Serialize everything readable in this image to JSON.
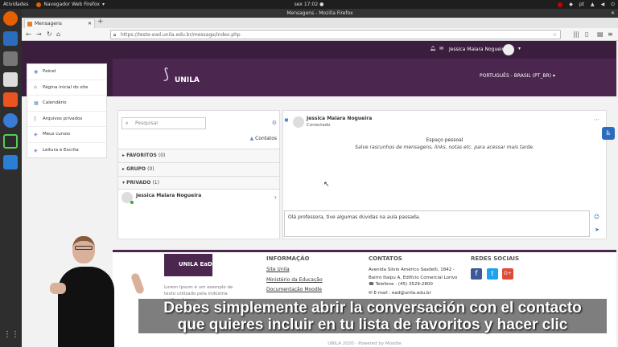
{
  "system": {
    "activities": "Atividades",
    "app_menu": "Navegador Web Firefox",
    "clock": "sex 17:02 ●",
    "lang": "pt"
  },
  "window": {
    "title": "Mensagens - Mozilla Firefox"
  },
  "browser": {
    "tab_label": "Mensagens",
    "url": "https://teste-ead.unila.edu.br/message/index.php"
  },
  "moodle": {
    "user_name": "Jessica Maiara Nogueira",
    "language": "PORTUGUÊS - BRASIL (PT_BR)",
    "logo": "UNILA",
    "nav": [
      {
        "label": "Painel",
        "icon": "dashboard-icon"
      },
      {
        "label": "Página inicial do site",
        "icon": "home-icon"
      },
      {
        "label": "Calendário",
        "icon": "calendar-icon"
      },
      {
        "label": "Arquivos privados",
        "icon": "file-icon"
      },
      {
        "label": "Meus cursos",
        "icon": "graduation-cap-icon"
      },
      {
        "label": "Leitura e Escrita",
        "icon": "graduation-cap-icon"
      }
    ]
  },
  "messaging": {
    "search_placeholder": "Pesquisar",
    "contacts_label": "Contatos",
    "groups": [
      {
        "label": "FAVORITOS",
        "count": "(0)",
        "expanded": false
      },
      {
        "label": "GRUPO",
        "count": "(0)",
        "expanded": false
      },
      {
        "label": "PRIVADO",
        "count": "(1)",
        "expanded": true
      }
    ],
    "private_contact": "Jessica Maiara Nogueira",
    "conversation": {
      "name": "Jessica Maiara Nogueira",
      "status": "Conectado",
      "space_title": "Espaço pessoal",
      "space_hint": "Salve rascunhos de mensagens, links, notas etc. para acessar mais tarde.",
      "draft": "Olá professora, tive algumas dúvidas na aula passada."
    }
  },
  "footer": {
    "logo": "UNILA EaD",
    "lorem": "Lorem Ipsum é um exemplo de texto utilizado pela indústria gráfica. Lorem",
    "info_title": "INFORMAÇÃO",
    "info_links": [
      "Site Unila",
      "Ministério da Educação",
      "Documentação Moodle"
    ],
    "contacts_title": "CONTATOS",
    "address": "Avenida Silvio Américo Sasdelli, 1842 - Bairro Itaipu A, Edifício Comercial Lorivo",
    "phone": "Telefone : (45) 3529-2800",
    "email": "E-mail : ead@unila.edu.br",
    "social_title": "REDES SOCIAIS",
    "copyright": "UNILA 2020 - Powered by Moodle"
  },
  "captions": {
    "line1": "Debes simplemente abrir la conversación con el contacto",
    "line2": "que quieres incluir en tu lista de favoritos y hacer clic"
  },
  "colors": {
    "brand": "#4b2750",
    "brand_dark": "#3b1e3d",
    "link": "#6a8bbf"
  }
}
